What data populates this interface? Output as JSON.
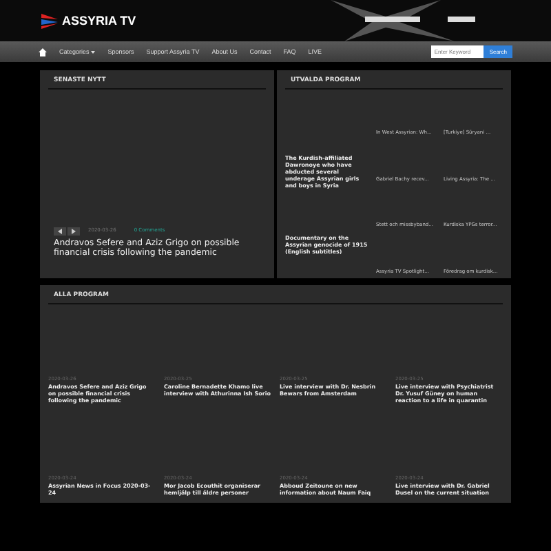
{
  "header": {
    "logo_text": "ASSYRIA TV"
  },
  "nav": {
    "items": [
      {
        "label": "Categories",
        "dropdown": true
      },
      {
        "label": "Sponsors",
        "dropdown": false
      },
      {
        "label": "Support Assyria TV",
        "dropdown": false
      },
      {
        "label": "About Us",
        "dropdown": false
      },
      {
        "label": "Contact",
        "dropdown": false
      },
      {
        "label": "FAQ",
        "dropdown": false
      },
      {
        "label": "LIVE",
        "dropdown": false
      }
    ],
    "search": {
      "placeholder": "Enter Keyword",
      "button": "Search"
    }
  },
  "latest": {
    "title": "SENASTE NYTT",
    "date": "2020-03-26",
    "category": "0 Comments",
    "headline": "Andravos Sefere and Aziz Grigo on possible financial crisis following the pandemic"
  },
  "selected": {
    "title": "UTVALDA PROGRAM",
    "featured": [
      "The Kurdish-affiliated Dawronoye who have abducted several underage Assyrian girls and boys in Syria",
      "Documentary on the Assyrian genocide of 1915 (English subtitles)"
    ],
    "items": [
      "In West Assyrian: Wh...",
      "[Turkiye] Süryani ...",
      "Gabriel Bachy recev...",
      "Living Assyria: The ...",
      "Stett och missbyband...",
      "Kurdiska YPGs terror...",
      "Assyria TV Spotlight...",
      "Föredrag om kurdisk..."
    ]
  },
  "all": {
    "title": "ALLA PROGRAM",
    "items": [
      {
        "date": "2020-03-26",
        "title": "Andravos Sefere and Aziz Grigo on possible financial crisis following the pandemic"
      },
      {
        "date": "2020-03-25",
        "title": "Caroline Bernadette Khamo live interview with Athurinna Ish Sorio"
      },
      {
        "date": "2020-03-25",
        "title": "Live interview with Dr. Nesbrin Bewars from Amsterdam"
      },
      {
        "date": "2020-03-25",
        "title": "Live interview with Psychiatrist Dr. Yusuf Güney on human reaction to a life in quarantin"
      },
      {
        "date": "2020-03-24",
        "title": "Assyrian News in Focus 2020-03-24"
      },
      {
        "date": "2020-03-24",
        "title": "Mor Jacob Ecouthit organiserar hemljälp till äldre personer"
      },
      {
        "date": "2020-03-24",
        "title": "Abboud Zeitoune on new information about Naum Faiq"
      },
      {
        "date": "2020-03-24",
        "title": "Live interview with Dr. Gabriel Dusel on the current situation"
      }
    ]
  }
}
